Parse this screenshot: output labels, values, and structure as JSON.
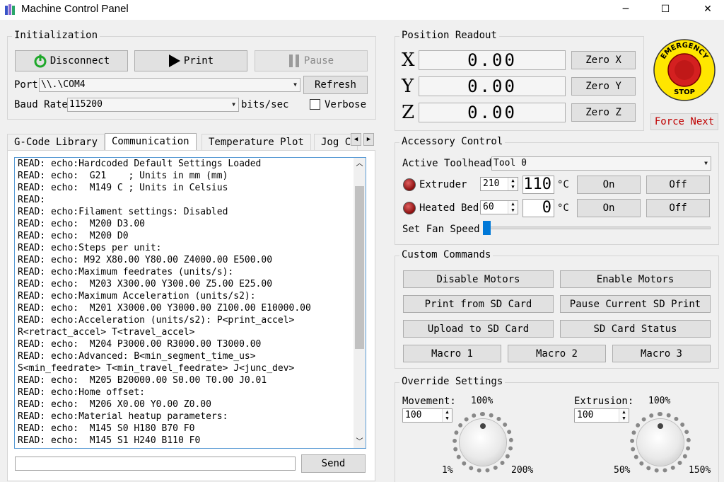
{
  "window": {
    "title": "Machine Control Panel",
    "minimize_icon": "─",
    "maximize_icon": "☐",
    "close_icon": "✕"
  },
  "initialization": {
    "title": "Initialization",
    "disconnect_label": "Disconnect",
    "print_label": "Print",
    "pause_label": "Pause",
    "port_label": "Port",
    "port_value": "\\\\.\\COM4",
    "refresh_label": "Refresh",
    "baud_label": "Baud Rate",
    "baud_value": "115200",
    "baud_unit": "bits/sec",
    "verbose_label": "Verbose",
    "verbose_checked": false
  },
  "tabs": [
    "G-Code Library",
    "Communication",
    "Temperature Plot",
    "Jog C"
  ],
  "active_tab": "Communication",
  "log_lines": [
    "READ: echo:Hardcoded Default Settings Loaded",
    "READ: echo:  G21    ; Units in mm (mm)",
    "READ: echo:  M149 C ; Units in Celsius",
    "READ:",
    "READ: echo:Filament settings: Disabled",
    "READ: echo:  M200 D3.00",
    "READ: echo:  M200 D0",
    "READ: echo:Steps per unit:",
    "READ: echo: M92 X80.00 Y80.00 Z4000.00 E500.00",
    "READ: echo:Maximum feedrates (units/s):",
    "READ: echo:  M203 X300.00 Y300.00 Z5.00 E25.00",
    "READ: echo:Maximum Acceleration (units/s2):",
    "READ: echo:  M201 X3000.00 Y3000.00 Z100.00 E10000.00",
    "READ: echo:Acceleration (units/s2): P<print_accel>",
    "R<retract_accel> T<travel_accel>",
    "READ: echo:  M204 P3000.00 R3000.00 T3000.00",
    "READ: echo:Advanced: B<min_segment_time_us>",
    "S<min_feedrate> T<min_travel_feedrate> J<junc_dev>",
    "READ: echo:  M205 B20000.00 S0.00 T0.00 J0.01",
    "READ: echo:Home offset:",
    "READ: echo:  M206 X0.00 Y0.00 Z0.00",
    "READ: echo:Material heatup parameters:",
    "READ: echo:  M145 S0 H180 B70 F0",
    "READ: echo:  M145 S1 H240 B110 F0"
  ],
  "command_input_value": "",
  "send_label": "Send",
  "position": {
    "title": "Position Readout",
    "axes": [
      {
        "axis": "X",
        "value": "0.00",
        "zero_label": "Zero X"
      },
      {
        "axis": "Y",
        "value": "0.00",
        "zero_label": "Zero Y"
      },
      {
        "axis": "Z",
        "value": "0.00",
        "zero_label": "Zero Z"
      }
    ]
  },
  "emergency": {
    "top_text": "EMERGENCY",
    "bottom_text": "STOP",
    "force_next_label": "Force Next"
  },
  "accessory": {
    "title": "Accessory Control",
    "toolhead_label": "Active Toolhead",
    "toolhead_value": "Tool 0",
    "extruder_label": "Extruder",
    "extruder_setpoint": "210",
    "extruder_temp": "110",
    "bed_label": "Heated Bed",
    "bed_setpoint": "60",
    "bed_temp": "0",
    "unit": "°C",
    "on_label": "On",
    "off_label": "Off",
    "fan_label": "Set Fan Speed",
    "fan_level": 0
  },
  "custom": {
    "title": "Custom Commands",
    "buttons": [
      "Disable Motors",
      "Enable Motors",
      "Print from SD Card",
      "Pause Current SD Print",
      "Upload to SD Card",
      "SD Card Status",
      "Macro 1",
      "Macro 2",
      "Macro 3"
    ]
  },
  "override": {
    "title": "Override Settings",
    "movement_label": "Movement:",
    "movement_value": "100",
    "movement_knob": "100%",
    "movement_min": "1%",
    "movement_max": "200%",
    "extrusion_label": "Extrusion:",
    "extrusion_value": "100",
    "extrusion_knob": "100%",
    "extrusion_min": "50%",
    "extrusion_max": "150%"
  },
  "colors": {
    "accent": "#5a9bd5",
    "force_next_text": "#c00000",
    "estop_yellow": "#ffe600",
    "estop_red": "#d42020",
    "power_green": "#1fa82b"
  }
}
